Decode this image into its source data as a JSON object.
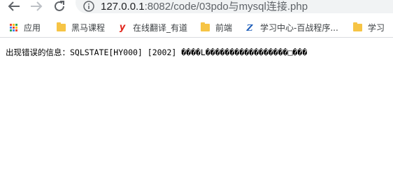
{
  "browser": {
    "url_host": "127.0.0.1",
    "url_path": ":8082/code/03pdo与mysql连接.php"
  },
  "bookmarks": [
    {
      "label": "应用",
      "icon": "apps-grid-icon"
    },
    {
      "label": "黑马课程",
      "icon": "folder-icon"
    },
    {
      "label": "在线翻译_有道",
      "icon": "youdao-icon"
    },
    {
      "label": "前端",
      "icon": "folder-icon"
    },
    {
      "label": "学习中心-百战程序...",
      "icon": "baizhan-icon"
    },
    {
      "label": "学习",
      "icon": "folder-icon"
    }
  ],
  "page": {
    "error_text": "出现错误的信息：SQLSTATE[HY000] [2002] ����L�����������������□���"
  },
  "colors": {
    "youdao_red": "#e1251b",
    "baizhan_blue": "#1a5bb8",
    "folder_yellow": "#f6c445"
  }
}
